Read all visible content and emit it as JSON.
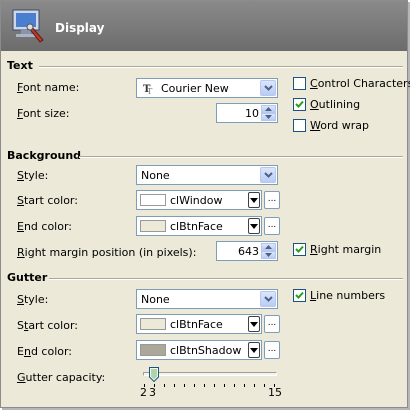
{
  "header": {
    "title": "Display",
    "icon": "monitor-settings-icon"
  },
  "text_section": {
    "title": "Text",
    "font_name_label": "Font name:",
    "font_name_value": "Courier New",
    "font_size_label": "Font size:",
    "font_size_value": "10",
    "control_characters": {
      "label": "Control Characters",
      "checked": false
    },
    "outlining": {
      "label": "Outlining",
      "checked": true
    },
    "word_wrap": {
      "label": "Word wrap",
      "checked": false
    }
  },
  "background_section": {
    "title": "Background",
    "style_label": "Style:",
    "style_value": "None",
    "start_color_label": "Start color:",
    "start_color_name": "clWindow",
    "start_color_hex": "#ffffff",
    "end_color_label": "End color:",
    "end_color_name": "clBtnFace",
    "end_color_hex": "#ece9d8",
    "right_margin_label": "Right margin position (in pixels):",
    "right_margin_value": "643",
    "right_margin_check": {
      "label": "Right margin",
      "checked": true
    }
  },
  "gutter_section": {
    "title": "Gutter",
    "style_label": "Style:",
    "style_value": "None",
    "start_color_label": "Start color:",
    "start_color_name": "clBtnFace",
    "start_color_hex": "#ece9d8",
    "end_color_label": "End color:",
    "end_color_name": "clBtnShadow",
    "end_color_hex": "#aca899",
    "line_numbers": {
      "label": "Line numbers",
      "checked": true
    },
    "capacity_label": "Gutter capacity:",
    "capacity_min": "2",
    "capacity_value": "3",
    "capacity_max": "15"
  },
  "ellipsis": "...",
  "colors": {
    "header_bg": "#7b7b7b",
    "panel_bg": "#ece9d8",
    "accent": "#316ac5"
  }
}
